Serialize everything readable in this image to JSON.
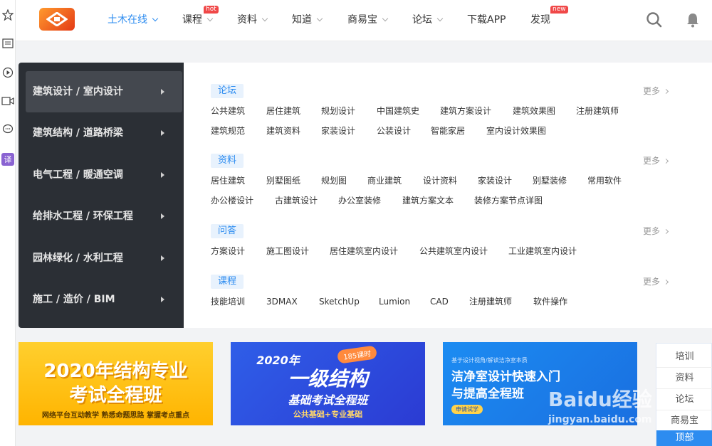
{
  "header": {
    "nav": [
      {
        "label": "土木在线",
        "active": true,
        "dropdown": true
      },
      {
        "label": "课程",
        "dropdown": true,
        "badge": "hot"
      },
      {
        "label": "资料",
        "dropdown": true
      },
      {
        "label": "知道",
        "dropdown": true
      },
      {
        "label": "商易宝",
        "dropdown": true
      },
      {
        "label": "论坛",
        "dropdown": true
      },
      {
        "label": "下载APP"
      },
      {
        "label": "发现",
        "badge": "new"
      }
    ],
    "icons": [
      "search-icon",
      "bell-icon"
    ],
    "accent": "#2d8cf0"
  },
  "left_strip": {
    "icons": [
      "star-icon",
      "news-icon",
      "play-icon",
      "video-icon",
      "chat-icon",
      "translate-icon"
    ],
    "translate_label": "译"
  },
  "categories": [
    "建筑设计 / 室内设计",
    "建筑结构 / 道路桥梁",
    "电气工程 / 暖通空调",
    "给排水工程 / 环保工程",
    "园林绿化 / 水利工程",
    "施工 / 造价 / BIM"
  ],
  "sections": [
    {
      "tag": "论坛",
      "more": "更多",
      "rows": [
        [
          "公共建筑",
          "居住建筑",
          "规划设计",
          "中国建筑史",
          "建筑方案设计",
          "建筑效果图",
          "注册建筑师"
        ],
        [
          "建筑规范",
          "建筑资料",
          "家装设计",
          "公装设计",
          "智能家居",
          "室内设计效果图"
        ]
      ]
    },
    {
      "tag": "资料",
      "more": "更多",
      "rows": [
        [
          "居住建筑",
          "别墅图纸",
          "规划图",
          "商业建筑",
          "设计资料",
          "家装设计",
          "别墅装修",
          "常用软件"
        ],
        [
          "办公楼设计",
          "古建筑设计",
          "办公室装修",
          "建筑方案文本",
          "装修方案节点详图"
        ]
      ]
    },
    {
      "tag": "问答",
      "more": "更多",
      "rows": [
        [
          "方案设计",
          "施工图设计",
          "居住建筑室内设计",
          "公共建筑室内设计",
          "工业建筑室内设计"
        ]
      ]
    },
    {
      "tag": "课程",
      "more": "更多",
      "rows": [
        [
          "技能培训",
          "3DMAX",
          "SketchUp",
          "Lumion",
          "CAD",
          "注册建筑师",
          "软件操作"
        ]
      ]
    }
  ],
  "banners": [
    {
      "line1": "2020年结构专业",
      "line2": "考试全程班",
      "sub": "网络平台互动教学  熟悉命题思路  掌握考点重点"
    },
    {
      "line1": "2020年",
      "line2": "一级结构",
      "line3": "基础考试全程班",
      "sub": "公共基础+专业基础",
      "badge": "185课时"
    },
    {
      "kicker": "基于设计视角/解读洁净室本质",
      "line1": "洁净室设计快速入门",
      "line2": "与提高全程班",
      "sub": "申请试学"
    }
  ],
  "float_menu": [
    "培训",
    "资料",
    "论坛",
    "商易宝",
    "顶部"
  ],
  "watermark": {
    "brand": "Baidu经验",
    "url": "jingyan.baidu.com"
  }
}
